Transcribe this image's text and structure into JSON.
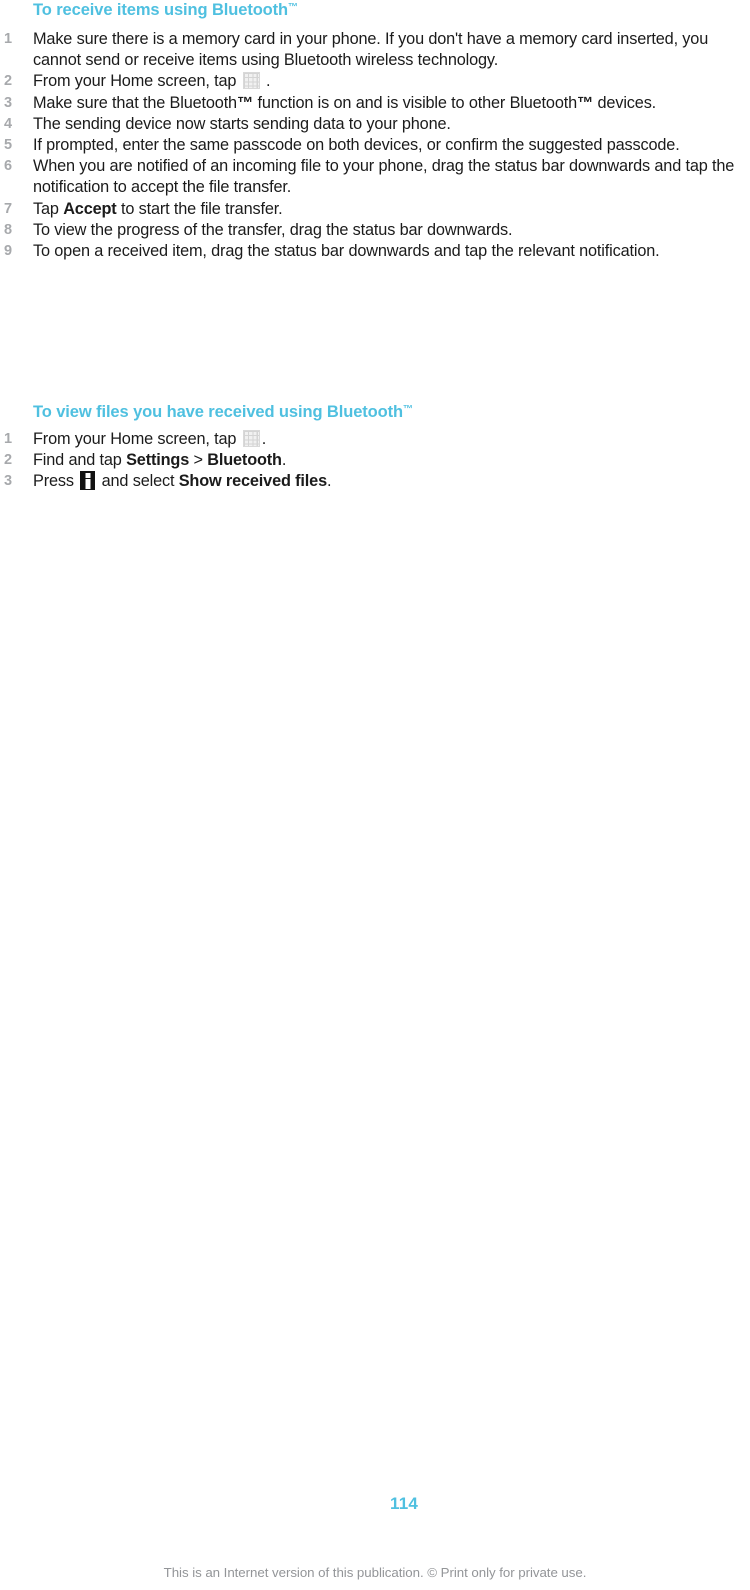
{
  "document": {
    "page_number": "114",
    "footer_note": "This is an Internet version of this publication. © Print only for private use.",
    "accent_color": "#4fc0e0",
    "text_color": "#1b1b1b",
    "number_color": "#a7a9ac",
    "footer_color": "#939598"
  },
  "sections": [
    {
      "heading": "To receive items using Bluetooth™",
      "heading_base": "To receive items using Bluetooth",
      "heading_tm": "™",
      "steps": [
        {
          "number": "1",
          "parts": [
            {
              "type": "text",
              "value": "Make sure there is a memory card in your phone. If you don't have a memory card inserted, you cannot send or receive items using Bluetooth wireless technology."
            }
          ]
        },
        {
          "number": "2",
          "parts": [
            {
              "type": "text",
              "value": "From your Home screen, tap "
            },
            {
              "type": "icon",
              "value": "app-grid-icon"
            },
            {
              "type": "text",
              "value": " ."
            }
          ]
        },
        {
          "number": "3",
          "parts": [
            {
              "type": "text",
              "value": "Make sure that the Bluetooth"
            },
            {
              "type": "bold",
              "value": "™"
            },
            {
              "type": "text",
              "value": " function is on and is visible to other Bluetooth"
            },
            {
              "type": "bold",
              "value": "™"
            },
            {
              "type": "text",
              "value": " devices."
            }
          ]
        },
        {
          "number": "4",
          "parts": [
            {
              "type": "text",
              "value": "The sending device now starts sending data to your phone."
            }
          ]
        },
        {
          "number": "5",
          "parts": [
            {
              "type": "text",
              "value": "If prompted, enter the same passcode on both devices, or confirm the suggested passcode."
            }
          ]
        },
        {
          "number": "6",
          "parts": [
            {
              "type": "text",
              "value": "When you are notified of an incoming file to your phone, drag the status bar downwards and tap the notification to accept the file transfer."
            }
          ]
        },
        {
          "number": "7",
          "parts": [
            {
              "type": "text",
              "value": "Tap "
            },
            {
              "type": "bold",
              "value": "Accept"
            },
            {
              "type": "text",
              "value": " to start the file transfer."
            }
          ]
        },
        {
          "number": "8",
          "parts": [
            {
              "type": "text",
              "value": "To view the progress of the transfer, drag the status bar downwards."
            }
          ]
        },
        {
          "number": "9",
          "parts": [
            {
              "type": "text",
              "value": "To open a received item, drag the status bar downwards and tap the relevant notification."
            }
          ]
        }
      ]
    },
    {
      "heading": "To view files you have received using Bluetooth™",
      "heading_base": "To view files you have received using Bluetooth",
      "heading_tm": "™",
      "steps": [
        {
          "number": "1",
          "parts": [
            {
              "type": "text",
              "value": "From your Home screen, tap "
            },
            {
              "type": "icon",
              "value": "app-grid-icon"
            },
            {
              "type": "text",
              "value": "."
            }
          ]
        },
        {
          "number": "2",
          "parts": [
            {
              "type": "text",
              "value": "Find and tap "
            },
            {
              "type": "bold",
              "value": "Settings"
            },
            {
              "type": "text",
              "value": " > "
            },
            {
              "type": "bold",
              "value": "Bluetooth"
            },
            {
              "type": "text",
              "value": "."
            }
          ]
        },
        {
          "number": "3",
          "parts": [
            {
              "type": "text",
              "value": "Press "
            },
            {
              "type": "icon",
              "value": "menu-key-icon"
            },
            {
              "type": "text",
              "value": " and select "
            },
            {
              "type": "bold",
              "value": "Show received files"
            },
            {
              "type": "text",
              "value": "."
            }
          ]
        }
      ]
    }
  ]
}
